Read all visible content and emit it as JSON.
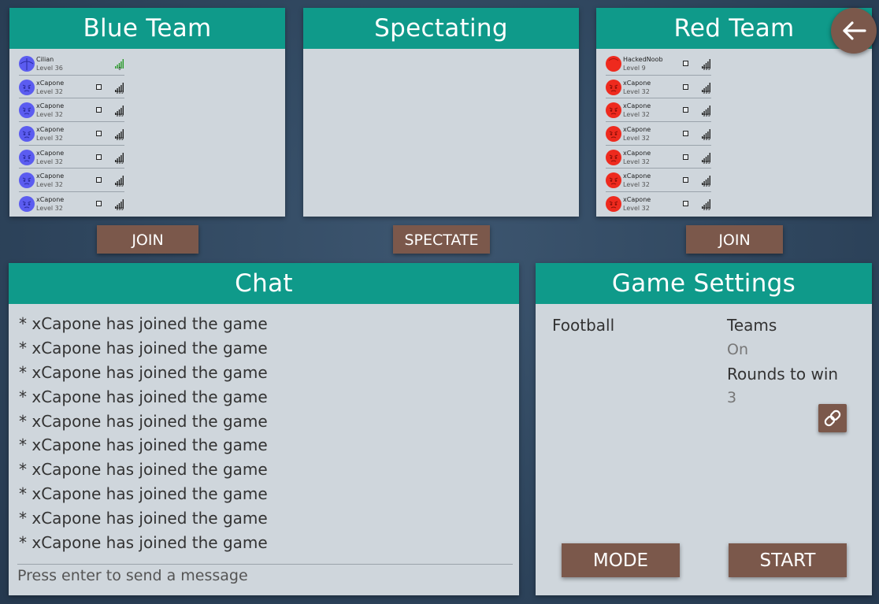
{
  "blue_team": {
    "title": "Blue Team",
    "players": [
      {
        "name": "Cilian",
        "level": "Level 36",
        "ping": "0",
        "avatar": "blue-globe",
        "show_check": false
      },
      {
        "name": "xCapone",
        "level": "Level 32",
        "ping": "999",
        "avatar": "blue-face",
        "show_check": true
      },
      {
        "name": "xCapone",
        "level": "Level 32",
        "ping": "999",
        "avatar": "blue-face",
        "show_check": true
      },
      {
        "name": "xCapone",
        "level": "Level 32",
        "ping": "999",
        "avatar": "blue-face",
        "show_check": true
      },
      {
        "name": "xCapone",
        "level": "Level 32",
        "ping": "999",
        "avatar": "blue-face",
        "show_check": true
      },
      {
        "name": "xCapone",
        "level": "Level 32",
        "ping": "999",
        "avatar": "blue-face",
        "show_check": true
      },
      {
        "name": "xCapone",
        "level": "Level 32",
        "ping": "999",
        "avatar": "blue-face",
        "show_check": true
      }
    ],
    "join_label": "JOIN"
  },
  "spectating": {
    "title": "Spectating",
    "spectate_label": "SPECTATE"
  },
  "red_team": {
    "title": "Red Team",
    "players": [
      {
        "name": "HackedNoob",
        "level": "Level 9",
        "ping": "999",
        "avatar": "red-plain",
        "show_check": true
      },
      {
        "name": "xCapone",
        "level": "Level 32",
        "ping": "999",
        "avatar": "red-face",
        "show_check": true
      },
      {
        "name": "xCapone",
        "level": "Level 32",
        "ping": "999",
        "avatar": "red-face",
        "show_check": true
      },
      {
        "name": "xCapone",
        "level": "Level 32",
        "ping": "999",
        "avatar": "red-face",
        "show_check": true
      },
      {
        "name": "xCapone",
        "level": "Level 32",
        "ping": "999",
        "avatar": "red-face",
        "show_check": true
      },
      {
        "name": "xCapone",
        "level": "Level 32",
        "ping": "999",
        "avatar": "red-face",
        "show_check": true
      },
      {
        "name": "xCapone",
        "level": "Level 32",
        "ping": "999",
        "avatar": "red-face",
        "show_check": true
      }
    ],
    "join_label": "JOIN"
  },
  "chat": {
    "title": "Chat",
    "messages": [
      "* xCapone has joined the game",
      "* xCapone has joined the game",
      "* xCapone has joined the game",
      "* xCapone has joined the game",
      "* xCapone has joined the game",
      "* xCapone has joined the game",
      "* xCapone has joined the game",
      "* xCapone has joined the game",
      "* xCapone has joined the game",
      "* xCapone has joined the game"
    ],
    "input_placeholder": "Press enter to send a message"
  },
  "game_settings": {
    "title": "Game Settings",
    "mode_name": "Football",
    "teams_label": "Teams",
    "teams_value": "On",
    "rounds_label": "Rounds to win",
    "rounds_value": "3",
    "mode_button": "MODE",
    "start_button": "START"
  },
  "icons": {
    "back": "arrow-left-icon",
    "link": "link-icon",
    "signal": "signal-bars-icon"
  },
  "colors": {
    "header": "#0f9a8a",
    "panel": "#cfd6dc",
    "button": "#7b584b",
    "blue_avatar": "#5b5cf0",
    "red_avatar": "#ee2a1e"
  }
}
